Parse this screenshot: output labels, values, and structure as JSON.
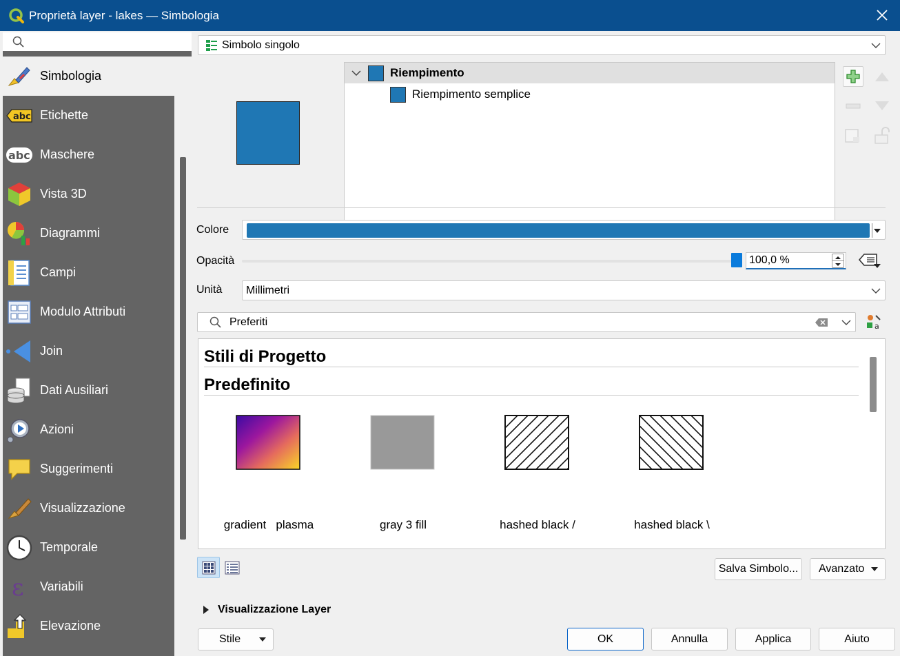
{
  "window": {
    "title": "Proprietà layer - lakes — Simbologia"
  },
  "sidebar": {
    "search_placeholder": "",
    "items": [
      {
        "label": "Simbologia",
        "icon": "paintbrush-icon",
        "active": true
      },
      {
        "label": "Etichette",
        "icon": "abc-label-icon"
      },
      {
        "label": "Maschere",
        "icon": "abc-mask-icon"
      },
      {
        "label": "Vista 3D",
        "icon": "cube-3d-icon"
      },
      {
        "label": "Diagrammi",
        "icon": "diagram-icon"
      },
      {
        "label": "Campi",
        "icon": "fields-icon"
      },
      {
        "label": "Modulo Attributi",
        "icon": "form-icon"
      },
      {
        "label": "Join",
        "icon": "join-icon"
      },
      {
        "label": "Dati Ausiliari",
        "icon": "auxiliary-data-icon"
      },
      {
        "label": "Azioni",
        "icon": "actions-gear-icon"
      },
      {
        "label": "Suggerimenti",
        "icon": "speech-bubble-icon"
      },
      {
        "label": "Visualizzazione",
        "icon": "rendering-brush-icon"
      },
      {
        "label": "Temporale",
        "icon": "clock-icon"
      },
      {
        "label": "Variabili",
        "icon": "epsilon-icon"
      },
      {
        "label": "Elevazione",
        "icon": "elevation-icon"
      }
    ]
  },
  "renderer": {
    "value": "Simbolo singolo"
  },
  "symbol_tree": {
    "root": "Riempimento",
    "child": "Riempimento semplice"
  },
  "colors": {
    "fill": "#1f77b4",
    "title_bar": "#0a4f8f",
    "sidebar_bg": "#646464"
  },
  "properties": {
    "color_label": "Colore",
    "opacity_label": "Opacità",
    "opacity_value": "100,0 %",
    "opacity_fraction": 1.0,
    "unit_label": "Unità",
    "unit_value": "Millimetri"
  },
  "style_search": {
    "value": "Preferiti"
  },
  "gallery": {
    "groups": [
      "Stili di Progetto",
      "Predefinito"
    ],
    "symbols": [
      {
        "name": "gradient   plasma",
        "kind": "gradient"
      },
      {
        "name": "gray 3 fill",
        "kind": "gray"
      },
      {
        "name": "hashed black /",
        "kind": "hatch-forward"
      },
      {
        "name": "hashed black \\",
        "kind": "hatch-back"
      }
    ]
  },
  "actions": {
    "save_symbol": "Salva Simbolo...",
    "advanced": "Avanzato",
    "layer_rendering": "Visualizzazione Layer",
    "style": "Stile",
    "ok": "OK",
    "cancel": "Annulla",
    "apply": "Applica",
    "help": "Aiuto"
  }
}
